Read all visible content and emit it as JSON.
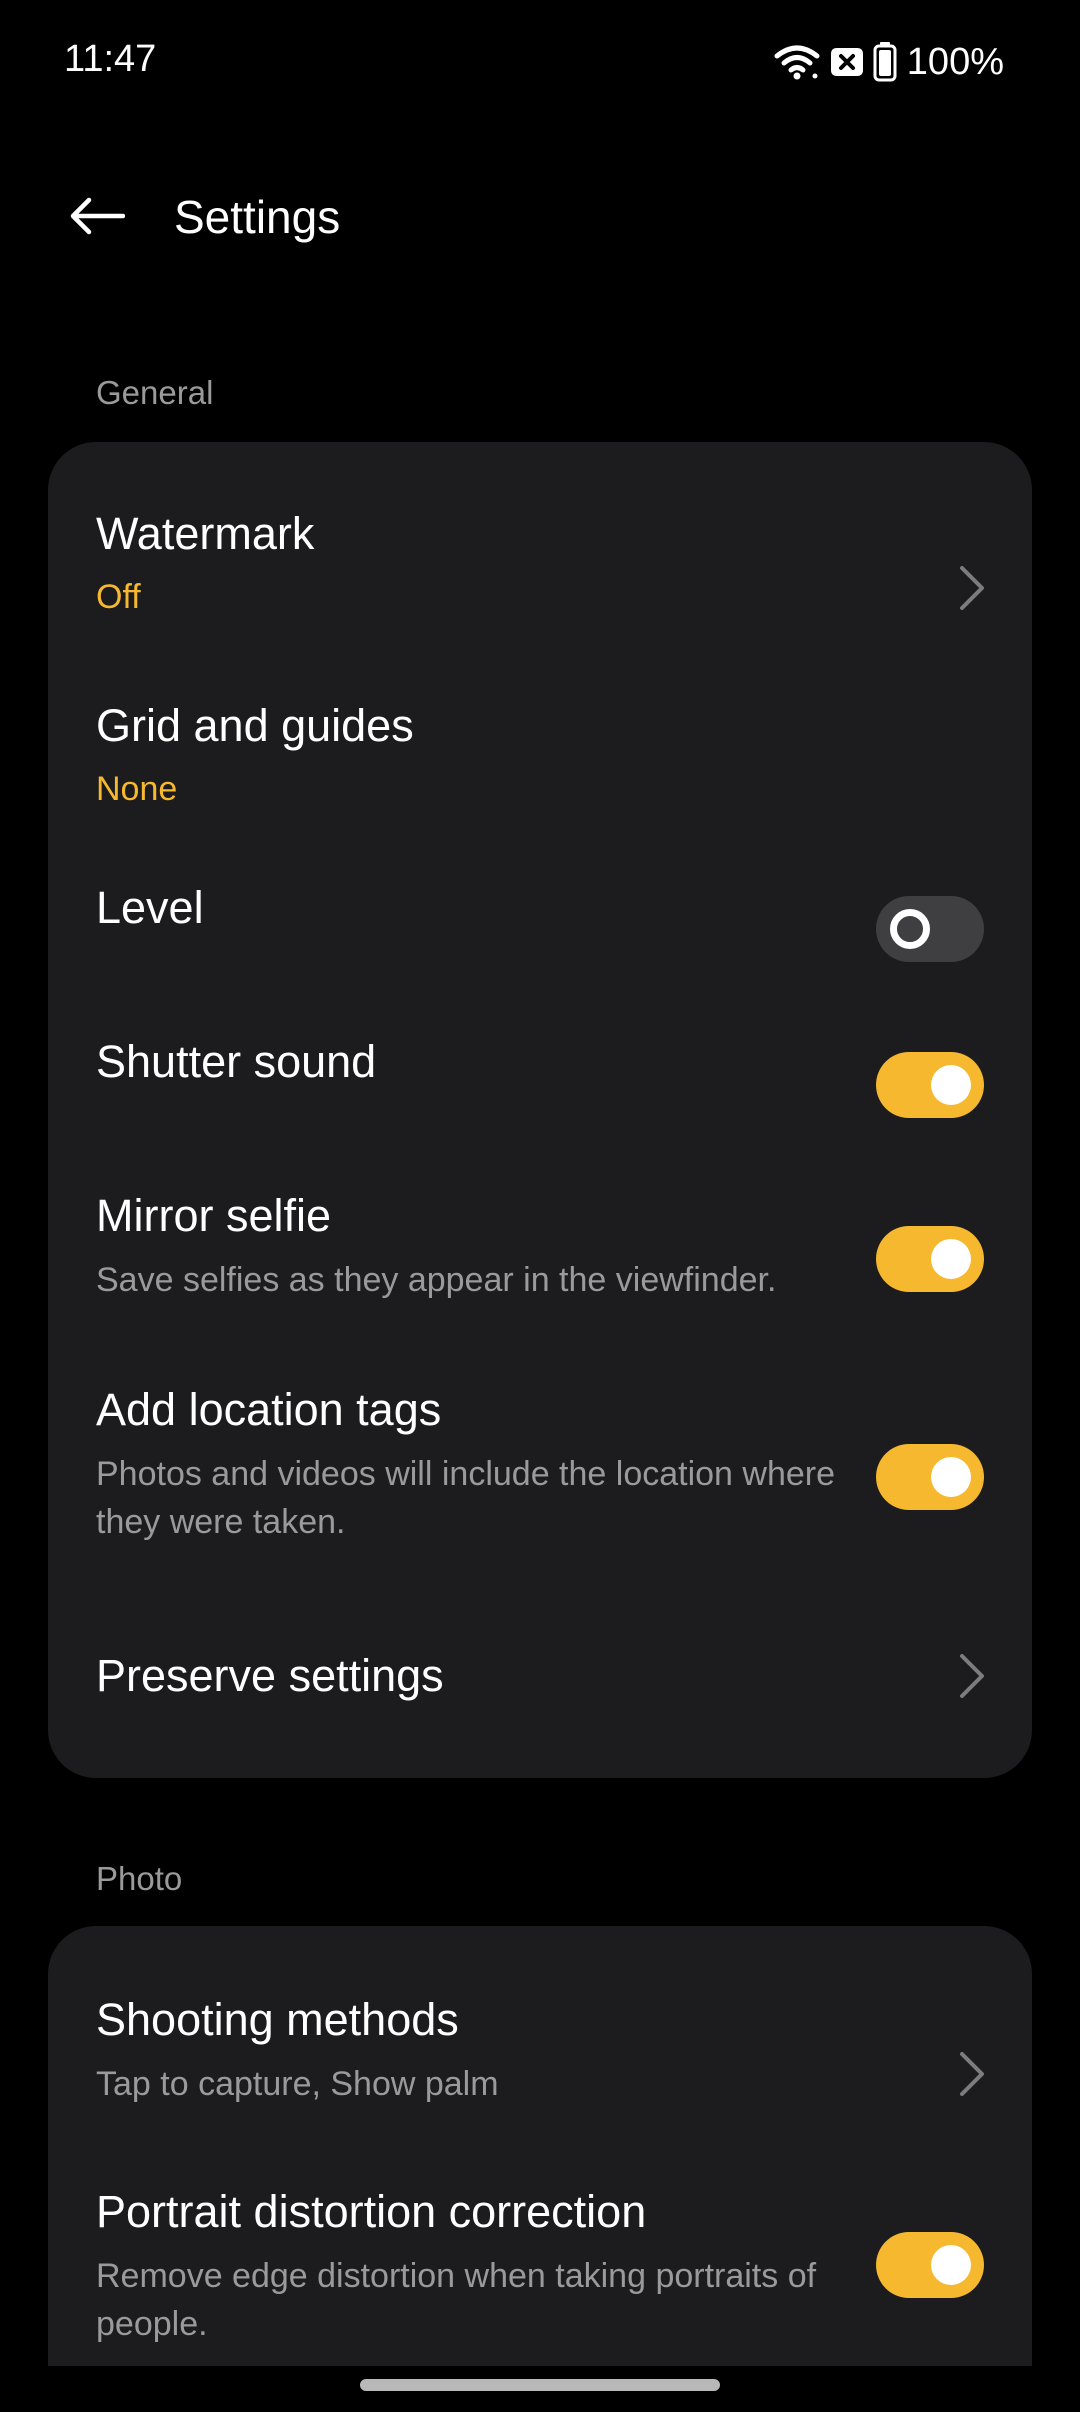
{
  "status_bar": {
    "time": "11:47",
    "battery": "100%",
    "icons": [
      "wifi-icon",
      "no-sim-icon",
      "battery-icon"
    ]
  },
  "header": {
    "title": "Settings",
    "back_icon": "back-arrow-icon"
  },
  "sections": {
    "general": {
      "label": "General",
      "items": {
        "watermark": {
          "title": "Watermark",
          "value": "Off"
        },
        "grid": {
          "title": "Grid and guides",
          "value": "None"
        },
        "level": {
          "title": "Level",
          "enabled": false
        },
        "shutter": {
          "title": "Shutter sound",
          "enabled": true
        },
        "mirror": {
          "title": "Mirror selfie",
          "description": "Save selfies as they appear in the viewfinder.",
          "enabled": true
        },
        "location": {
          "title": "Add location tags",
          "description": "Photos and videos will include the location where they were taken.",
          "enabled": true
        },
        "preserve": {
          "title": "Preserve settings"
        }
      }
    },
    "photo": {
      "label": "Photo",
      "items": {
        "shooting": {
          "title": "Shooting methods",
          "description": "Tap to capture, Show palm"
        },
        "portrait": {
          "title": "Portrait distortion correction",
          "description": "Remove edge distortion when taking portraits of people.",
          "enabled": true
        }
      }
    }
  },
  "colors": {
    "accent": "#f5b82e",
    "card_background": "#1c1c1e",
    "page_background": "#000000",
    "secondary_text": "#9a9a9a",
    "toggle_off_track": "#3f3f41"
  }
}
